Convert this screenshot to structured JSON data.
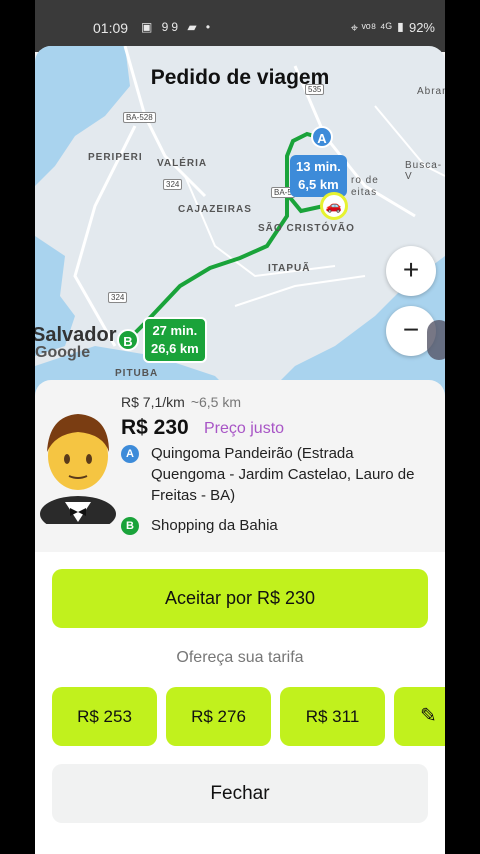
{
  "status_bar": {
    "time": "01:09",
    "notif_icons": "▣ 99 ▰ •",
    "right": "⌖ ᵛᵒ⁸ ⁴ᴳ ▮ 92%"
  },
  "map": {
    "title": "Pedido de viagem",
    "places": [
      "PERIPERI",
      "VALÉRIA",
      "CAJAZEIRAS",
      "SÃO CRISTÓVÃO",
      "ITAPUÃ",
      "PITUBA",
      "Busca-V",
      "Abran",
      "ro de",
      "eitas"
    ],
    "roads": [
      "BA-528",
      "324",
      "324",
      "BA-5",
      "535"
    ],
    "city_label": "Salvador",
    "google_label": "Google",
    "pickup_pin": "A",
    "dest_pin": "B",
    "pickup_eta": {
      "line1": "13 min.",
      "line2": "6,5 km"
    },
    "trip_eta": {
      "line1": "27 min.",
      "line2": "26,6 km"
    },
    "zoom_in": "+",
    "zoom_out": "−",
    "colors": {
      "route": "#1aa33a",
      "pickup": "#3d8bd9"
    }
  },
  "ride": {
    "rate": "R$ 7,1/km",
    "distance": "~6,5 km",
    "price": "R$ 230",
    "fair_label": "Preço justo",
    "pickup_letter": "A",
    "pickup_address": "Quingoma Pandeirão (Estrada Quengoma - Jardim Castelao, Lauro de Freitas - BA)",
    "dest_letter": "B",
    "dest_address": "Shopping da Bahia"
  },
  "actions": {
    "accept": "Aceitar por R$ 230",
    "offer_label": "Ofereça sua tarifa",
    "fares": [
      "R$ 253",
      "R$ 276",
      "R$ 311"
    ],
    "edit_icon": "pencil-icon",
    "close": "Fechar",
    "accent": "#c1f11d"
  }
}
